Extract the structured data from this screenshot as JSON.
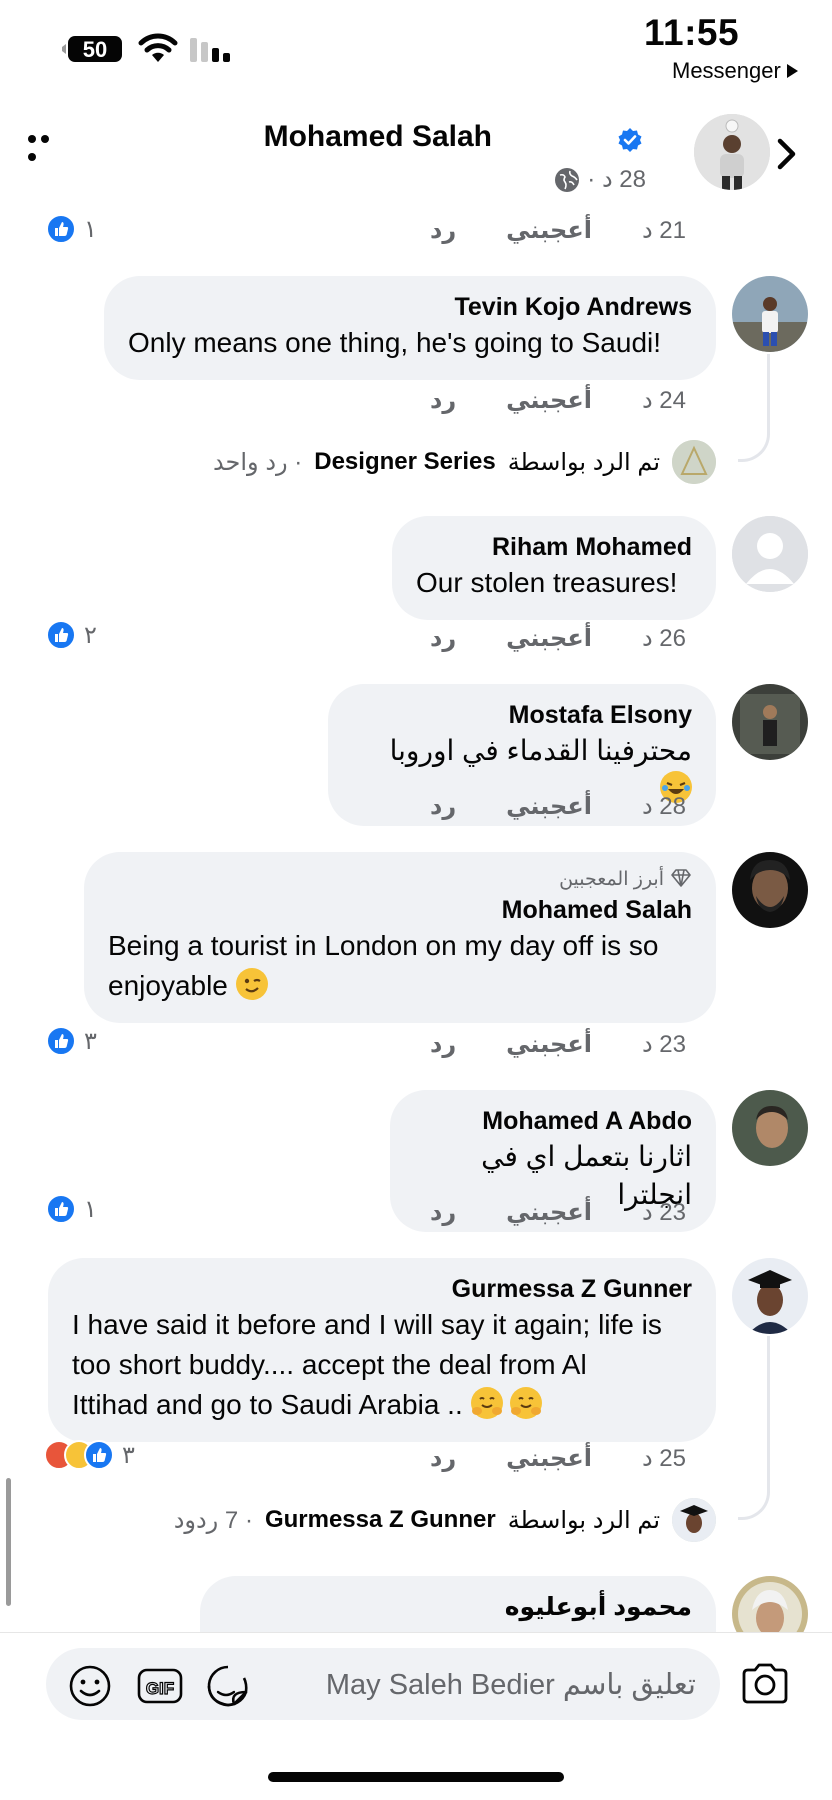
{
  "status_bar": {
    "time": "11:55",
    "back_app": "Messenger",
    "battery": "50"
  },
  "post_header": {
    "author": "Mohamed Salah",
    "time": "28 د ·"
  },
  "labels": {
    "like": "أعجبني",
    "reply": "ر‌د"
  },
  "top_actions": {
    "time": "21 د",
    "reactions": "١"
  },
  "comments": [
    {
      "author": "Tevin Kojo Andrews",
      "text": "Only means one thing, he's going to Saudi!",
      "time": "24 د",
      "reply_summary": {
        "prefix": "تم الرد بواسطة",
        "replier": "Designer Series",
        "count": "· رد واحد"
      }
    },
    {
      "author": "Riham Mohamed",
      "text": "Our stolen treasures!",
      "time": "26 د",
      "reactions": "٢"
    },
    {
      "author": "Mostafa Elsony",
      "text": "محترفينا  القدماء في اوروبا",
      "time": "28 د"
    },
    {
      "badge": "أبرز المعجبين",
      "author": "Mohamed Salah",
      "text_line1": "Being a tourist in London on my day off is so",
      "text_line2": "enjoyable",
      "time": "23 د",
      "reactions": "٣"
    },
    {
      "author": "Mohamed A Abdo",
      "text": "اثارنا بتعمل اي في انجلترا",
      "time": "23 د",
      "reactions": "١"
    },
    {
      "author": "Gurmessa Z Gunner",
      "text_line1": "I have said it before and I will say it again; life is",
      "text_line2": "too short buddy.... accept the deal from Al",
      "text_line3": "Ittihad and go to Saudi Arabia ..",
      "time": "25 د",
      "reactions": "٣",
      "reply_summary": {
        "prefix": "تم الرد بواسطة",
        "replier": "Gurmessa Z Gunner",
        "count": "· 7 ردود"
      }
    },
    {
      "author": "محمود أبوعليوه"
    }
  ],
  "composer": {
    "placeholder": "تعليق باسم May Saleh Bedier"
  },
  "icons": [
    "battery-icon",
    "wifi-icon",
    "signal-icon",
    "more-icon",
    "verified-icon",
    "globe-icon",
    "chevron-right-icon",
    "like-icon",
    "angry-icon",
    "haha-icon",
    "emoji-icon",
    "gif-icon",
    "sticker-icon",
    "camera-icon"
  ],
  "colors": {
    "accent": "#1877f2",
    "bubble": "#f0f2f5",
    "secondary_text": "#65676b"
  }
}
